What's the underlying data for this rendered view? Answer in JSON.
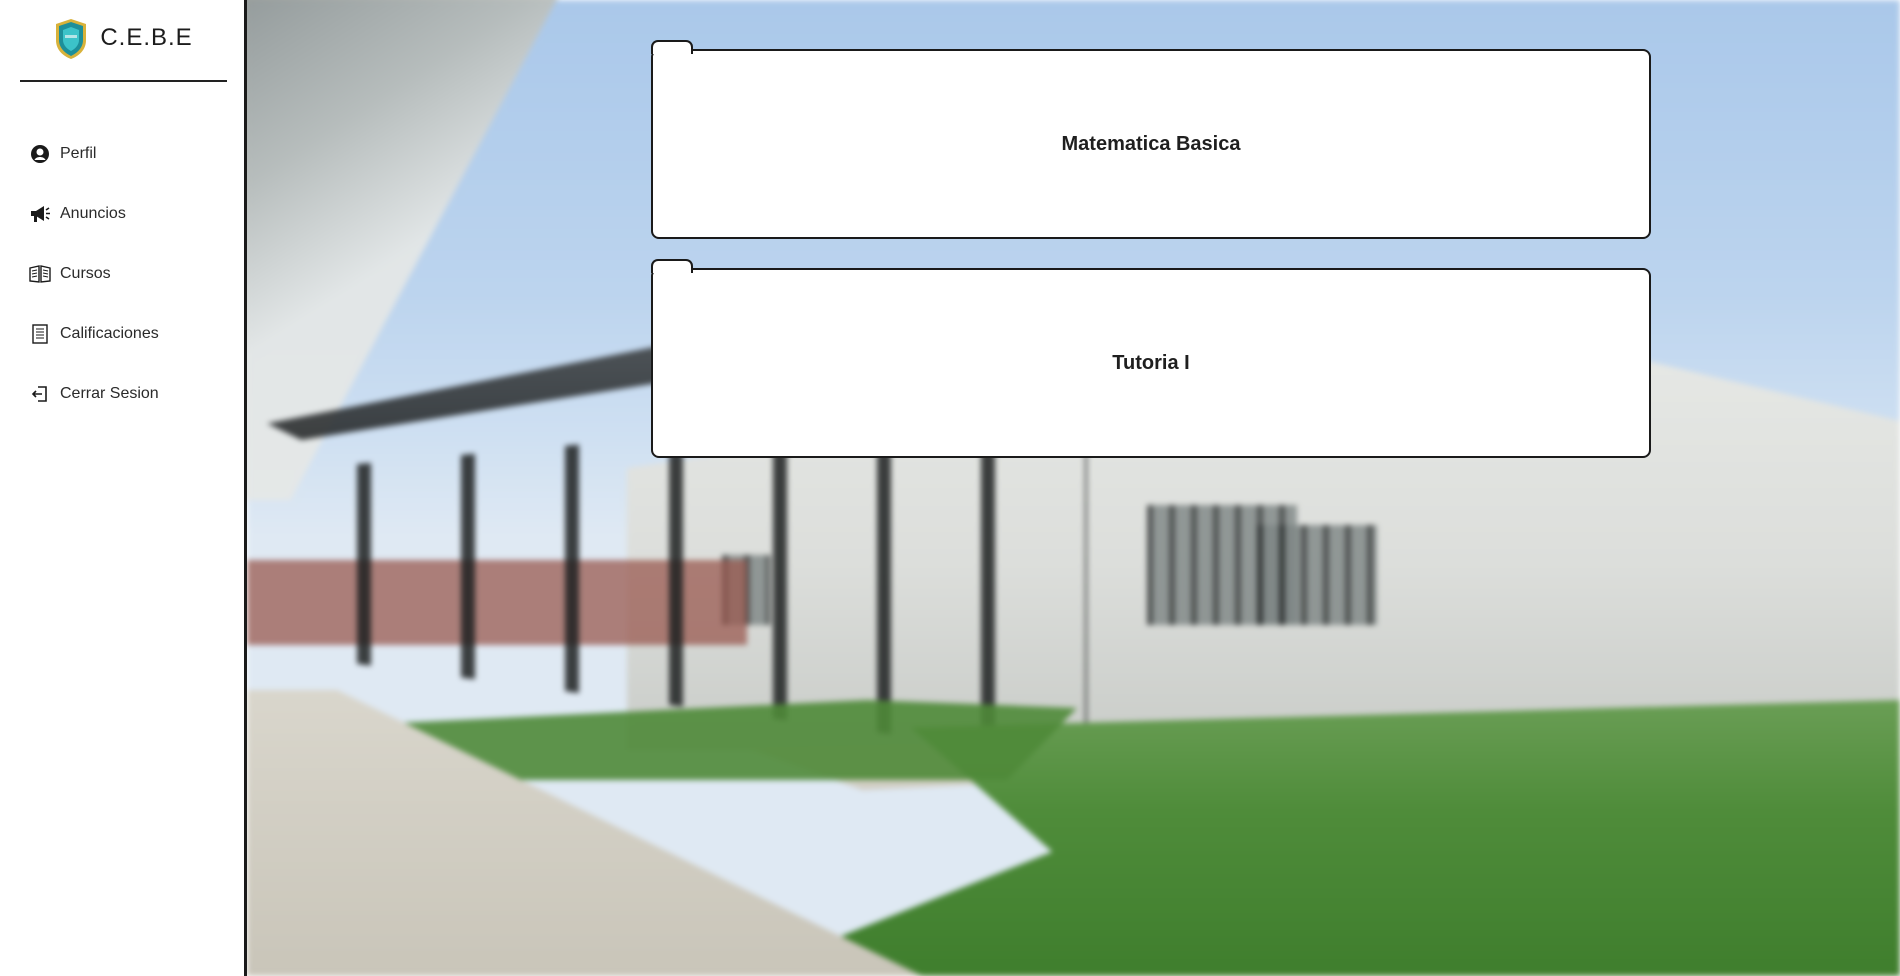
{
  "brand": {
    "title": "C.E.B.E",
    "logo_icon": "school-shield-logo",
    "logo_colors": {
      "shield": "#1d8f9a",
      "rim": "#d8b23a",
      "inner": "#3cc3c9"
    }
  },
  "sidebar": {
    "items": [
      {
        "label": "Perfil",
        "icon": "user-icon"
      },
      {
        "label": "Anuncios",
        "icon": "megaphone-icon"
      },
      {
        "label": "Cursos",
        "icon": "book-icon"
      },
      {
        "label": "Calificaciones",
        "icon": "clipboard-icon"
      },
      {
        "label": "Cerrar Sesion",
        "icon": "logout-icon"
      }
    ]
  },
  "courses": [
    {
      "title": "Matematica Basica"
    },
    {
      "title": "Tutoria I"
    }
  ],
  "colors": {
    "border": "#1a1a1a",
    "card_bg": "#ffffff",
    "text": "#1f1f1f"
  }
}
